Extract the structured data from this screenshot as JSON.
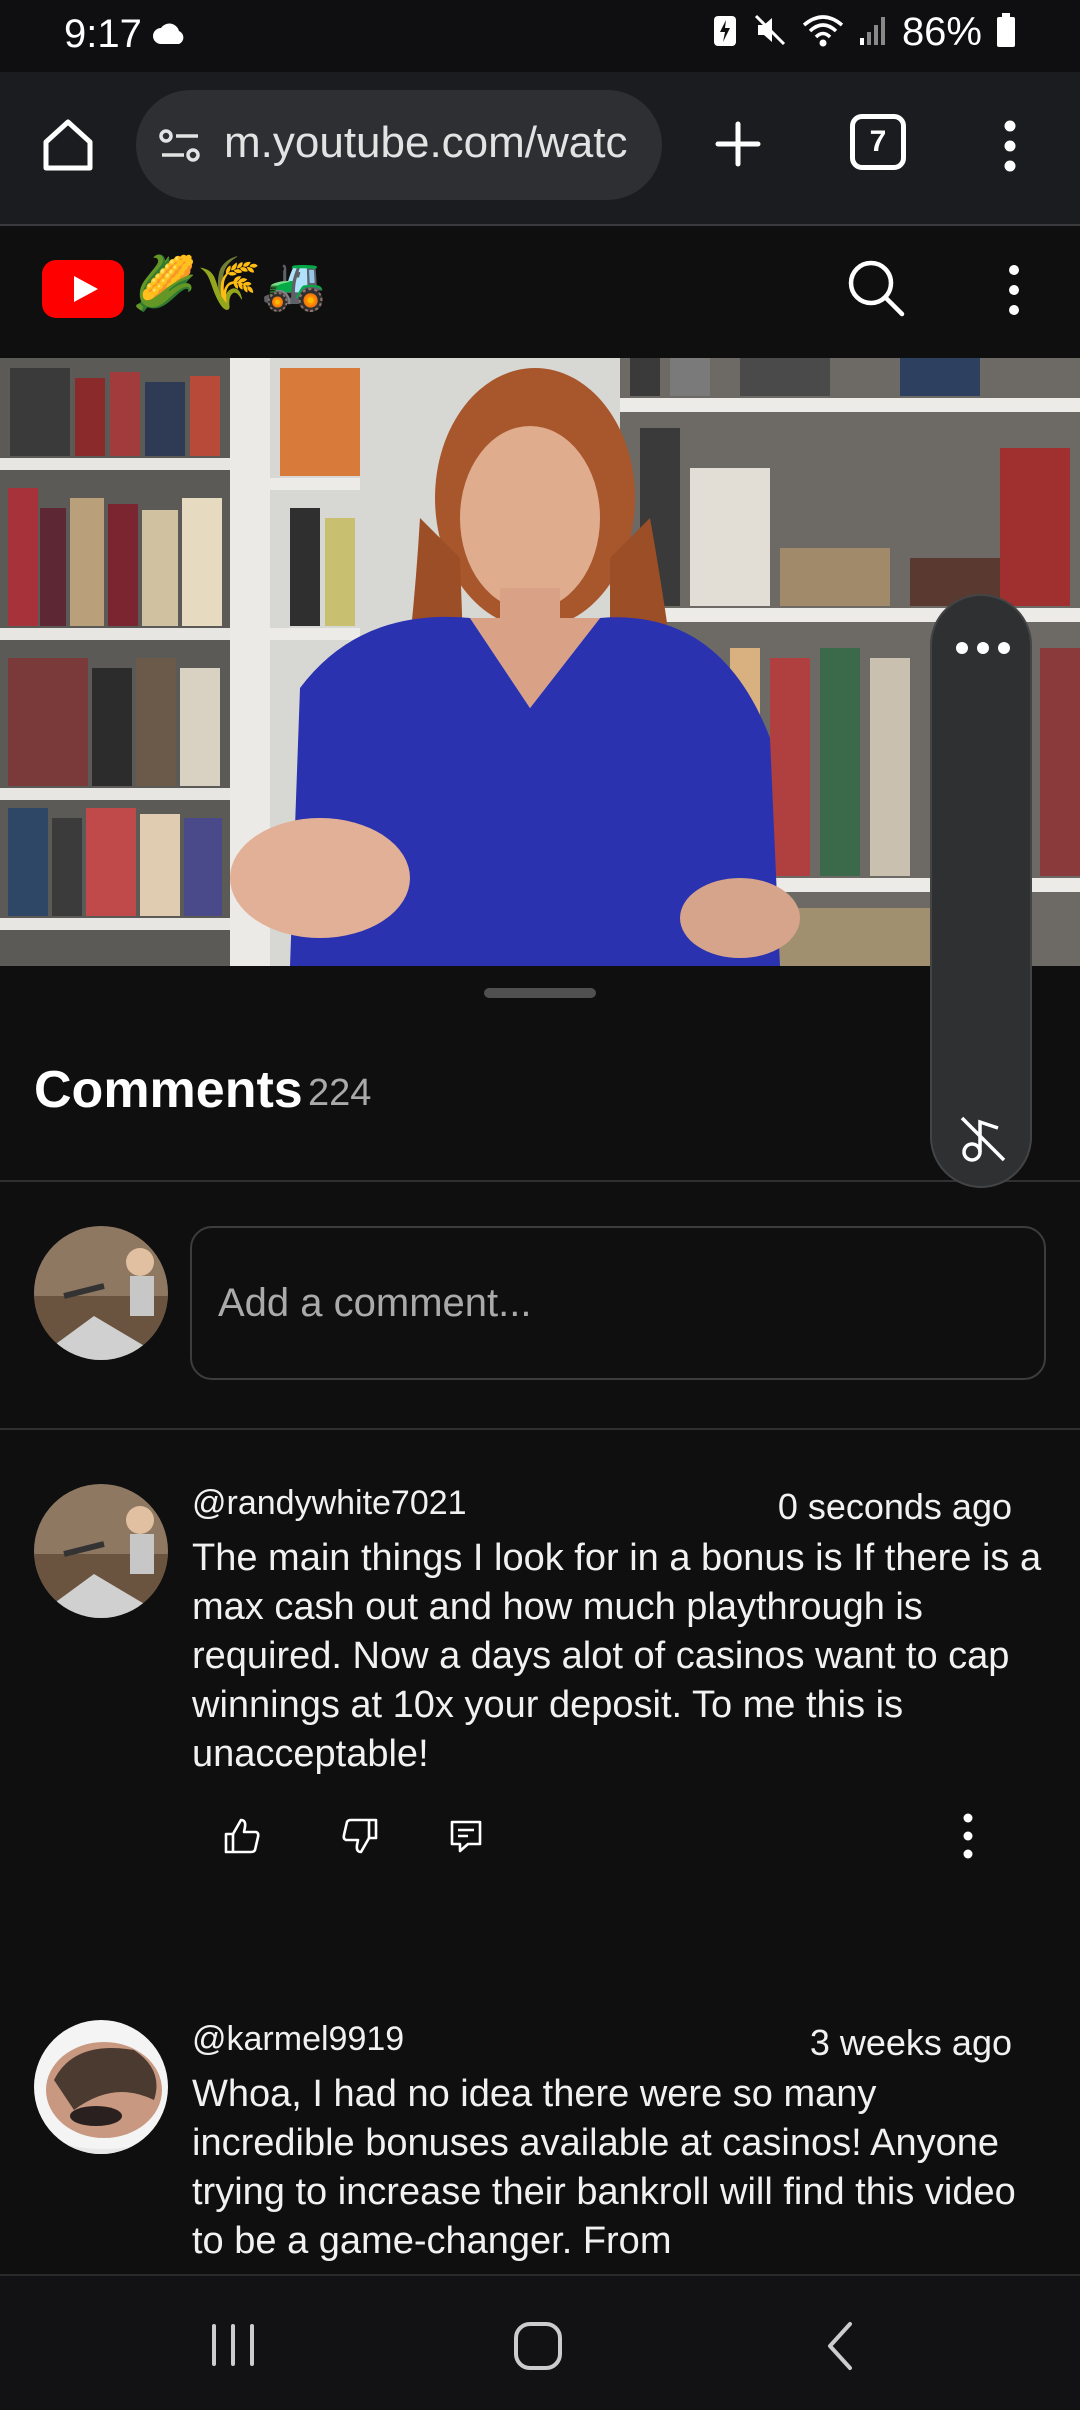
{
  "status_bar": {
    "time": "9:17",
    "battery": "86%"
  },
  "browser": {
    "url": "m.youtube.com/watc",
    "tab_count": "7",
    "icons": [
      "home-icon",
      "site-settings-icon",
      "plus-icon",
      "tabs-icon",
      "more-vert-icon"
    ]
  },
  "youtube": {
    "header_emoji": "🌽🌾🚜",
    "icons": [
      "youtube-logo",
      "search-icon",
      "more-vert-icon"
    ]
  },
  "comments": {
    "title": "Comments",
    "count": "224",
    "input_placeholder": "Add a comment...",
    "items": [
      {
        "author": "@randywhite7021",
        "time": "0 seconds ago",
        "text": "The main things I look for in a bonus is If there is a max cash out and how much playthrough is required. Now a days alot of casinos want to cap winnings at 10x your deposit. To me this is unacceptable!"
      },
      {
        "author": "@karmel9919",
        "time": "3 weeks ago",
        "text": "Whoa, I had no idea there were so many incredible bonuses available at casinos! Anyone trying to increase their bankroll will find this video to be a game-changer. From"
      }
    ]
  },
  "colors": {
    "accent_red": "#ff0000",
    "background": "#0f0f0f",
    "panel": "#2f3032"
  }
}
